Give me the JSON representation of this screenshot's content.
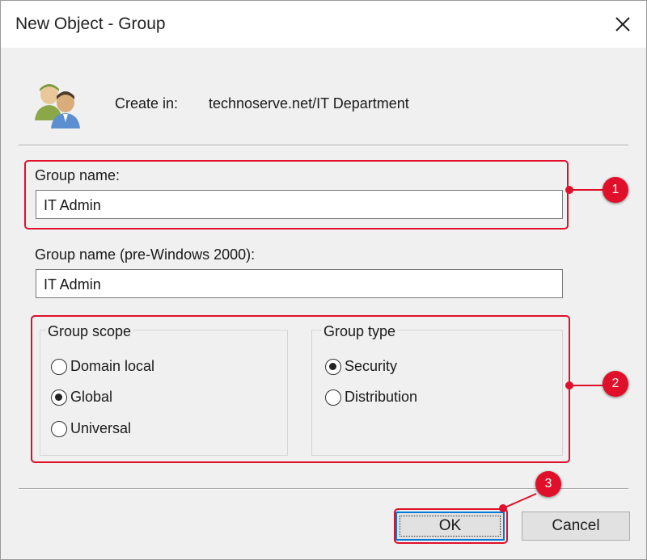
{
  "window": {
    "title": "New Object - Group"
  },
  "header": {
    "create_in_label": "Create in:",
    "create_in_value": "technoserve.net/IT Department",
    "icon": "group-users-icon"
  },
  "fields": {
    "group_name": {
      "label": "Group name:",
      "value": "IT Admin"
    },
    "group_name_pre2000": {
      "label": "Group name (pre-Windows 2000):",
      "value": "IT Admin"
    }
  },
  "group_scope": {
    "title": "Group scope",
    "options": [
      {
        "label": "Domain local",
        "checked": false
      },
      {
        "label": "Global",
        "checked": true
      },
      {
        "label": "Universal",
        "checked": false
      }
    ]
  },
  "group_type": {
    "title": "Group type",
    "options": [
      {
        "label": "Security",
        "checked": true
      },
      {
        "label": "Distribution",
        "checked": false
      }
    ]
  },
  "buttons": {
    "ok": "OK",
    "cancel": "Cancel"
  },
  "annotations": [
    "1",
    "2",
    "3"
  ],
  "colors": {
    "highlight": "#e0102a",
    "focus_blue": "#0078d7",
    "dialog_bg": "#f0f0f0"
  }
}
